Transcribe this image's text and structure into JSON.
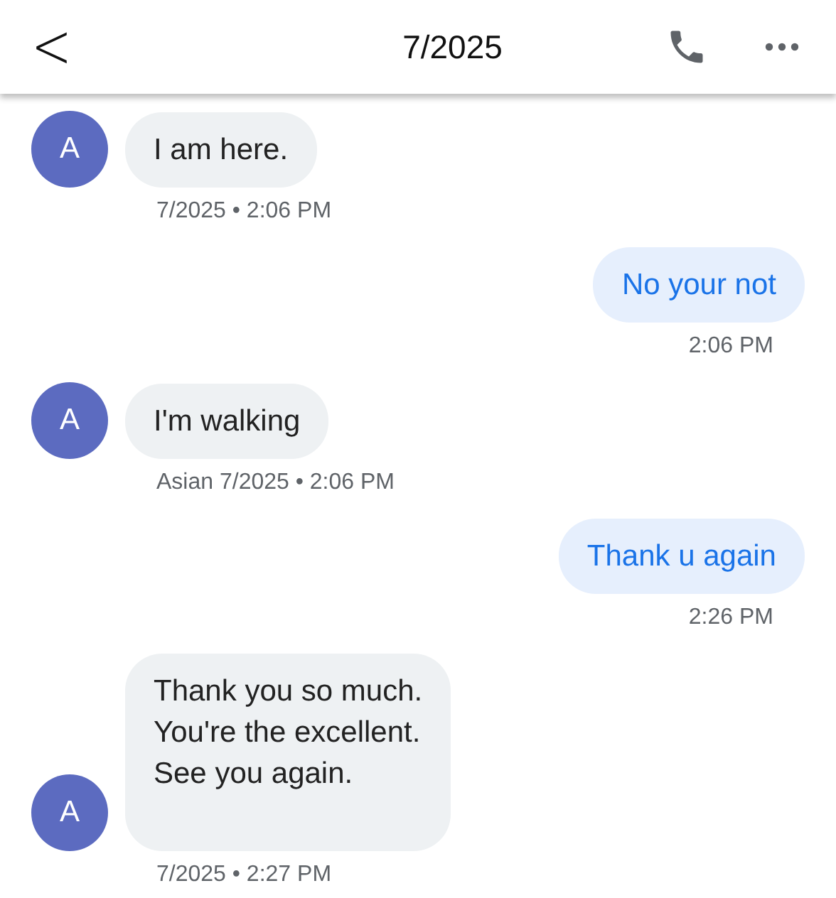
{
  "header": {
    "back": "<",
    "title": "7/2025"
  },
  "messages": [
    {
      "kind": "incoming",
      "avatar": "A",
      "text": "I am here.",
      "meta": "7/2025 • 2:06 PM"
    },
    {
      "kind": "outgoing",
      "text": "No your not",
      "meta": "2:06 PM"
    },
    {
      "kind": "incoming",
      "avatar": "A",
      "text": "I'm walking",
      "meta": "Asian 7/2025 • 2:06 PM"
    },
    {
      "kind": "outgoing",
      "text": "Thank u again",
      "meta": "2:26 PM"
    },
    {
      "kind": "incoming",
      "avatar": "A",
      "text": "Thank you so much.\nYou're the excellent.\nSee you again.",
      "meta": "7/2025 • 2:27 PM"
    }
  ]
}
